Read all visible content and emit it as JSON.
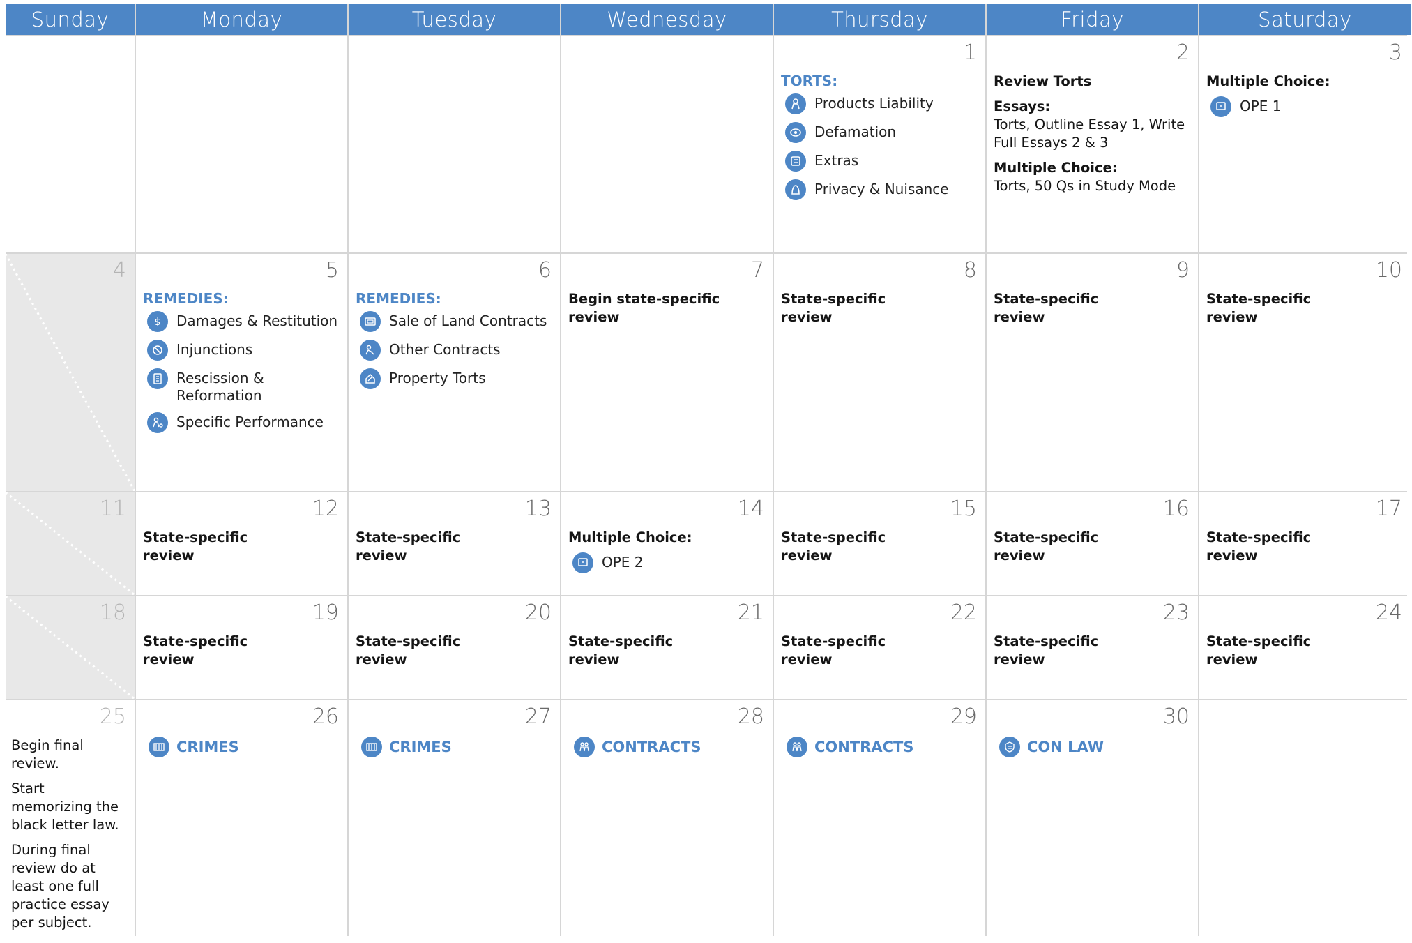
{
  "days_of_week": [
    "Sunday",
    "Monday",
    "Tuesday",
    "Wednesday",
    "Thursday",
    "Friday",
    "Saturday"
  ],
  "day_numbers": [
    "1",
    "2",
    "3",
    "4",
    "5",
    "6",
    "7",
    "8",
    "9",
    "10",
    "11",
    "12",
    "13",
    "14",
    "15",
    "16",
    "17",
    "18",
    "19",
    "20",
    "21",
    "22",
    "23",
    "24",
    "25",
    "26",
    "27",
    "28",
    "29",
    "30"
  ],
  "state_review": "State-specific review",
  "day1": {
    "heading": "TORTS:",
    "items": [
      {
        "label": "Products Liability",
        "icon": "products-liability-icon"
      },
      {
        "label": "Defamation",
        "icon": "defamation-icon"
      },
      {
        "label": "Extras",
        "icon": "extras-icon"
      },
      {
        "label": "Privacy & Nuisance",
        "icon": "privacy-nuisance-icon"
      }
    ]
  },
  "day2": {
    "title": "Review Torts",
    "essays_label": "Essays:",
    "essays_text": "Torts, Outline Essay 1, Write Full Essays 2 & 3",
    "mc_label": "Multiple Choice:",
    "mc_text": "Torts, 50 Qs in Study Mode"
  },
  "day3": {
    "mc_label": "Multiple Choice:",
    "item": "OPE 1"
  },
  "day5": {
    "heading": "REMEDIES:",
    "items": [
      {
        "label": "Damages & Restitution",
        "icon": "dollar-icon"
      },
      {
        "label": "Injunctions",
        "icon": "injunctions-icon"
      },
      {
        "label": "Rescission & Reformation",
        "icon": "rescission-icon"
      },
      {
        "label": "Specific Performance",
        "icon": "specific-performance-icon"
      }
    ]
  },
  "day6": {
    "heading": "REMEDIES:",
    "items": [
      {
        "label": "Sale of Land Contracts",
        "icon": "land-contracts-icon"
      },
      {
        "label": "Other Contracts",
        "icon": "other-contracts-icon"
      },
      {
        "label": "Property Torts",
        "icon": "property-torts-icon"
      }
    ]
  },
  "day7": {
    "text": "Begin state-specific review"
  },
  "day14": {
    "mc_label": "Multiple Choice:",
    "item": "OPE 2"
  },
  "day25": {
    "notes": [
      "Begin final review.",
      "Start memorizing the black letter law.",
      "During final review do at least one full practice essay per subject."
    ]
  },
  "subjects": {
    "d26": "CRIMES",
    "d27": "CRIMES",
    "d28": "CONTRACTS",
    "d29": "CONTRACTS",
    "d30": "CON LAW"
  },
  "colors": {
    "accent": "#4d86c6",
    "shade": "#e8e8e8",
    "grid": "#d6d6d6"
  }
}
